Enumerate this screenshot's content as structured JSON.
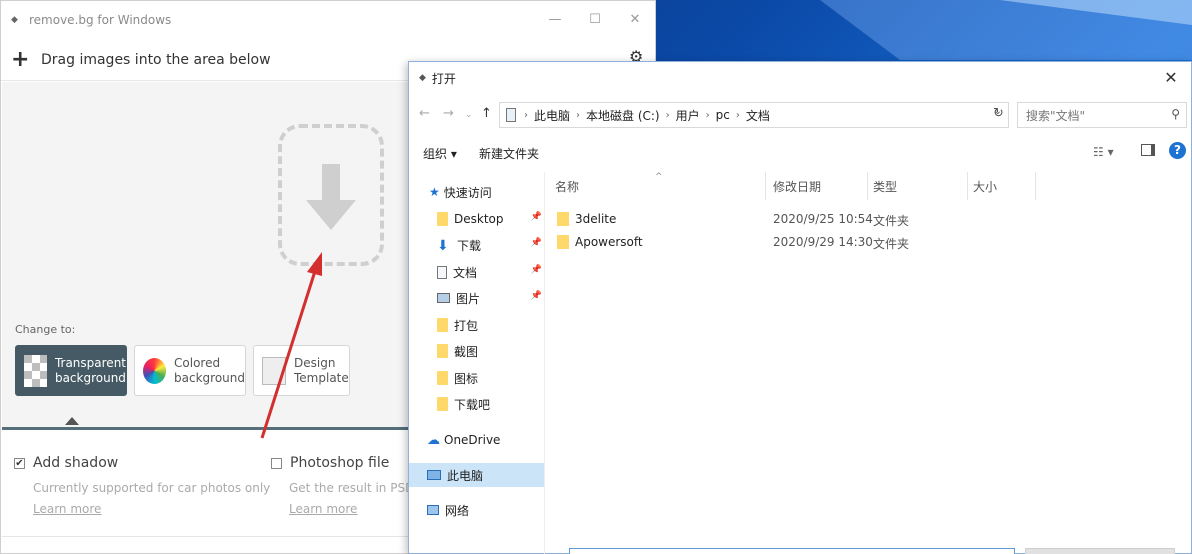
{
  "removebg": {
    "title": "remove.bg for Windows",
    "toolbar_label": "Drag images into the area below",
    "change_to_label": "Change to:",
    "options": [
      {
        "line1": "Transparent",
        "line2": "background"
      },
      {
        "line1": "Colored",
        "line2": "background"
      },
      {
        "line1": "Design",
        "line2": "Template"
      }
    ],
    "add_shadow": {
      "title": "Add shadow",
      "sub": "Currently supported for car photos only",
      "link": "Learn more"
    },
    "photoshop": {
      "title": "Photoshop file",
      "sub": "Get the result in PSD for",
      "link": "Learn more"
    },
    "colors": {
      "active_option": "#455a64",
      "divider": "#546e7a"
    }
  },
  "dialog": {
    "title": "打开",
    "breadcrumb": [
      "此电脑",
      "本地磁盘 (C:)",
      "用户",
      "pc",
      "文档"
    ],
    "search_placeholder": "搜索\"文档\"",
    "commands": {
      "organize": "组织 ▾",
      "new_folder": "新建文件夹"
    },
    "nav": {
      "quick_access": "快速访问",
      "items": [
        "Desktop",
        "下载",
        "文档",
        "图片",
        "打包",
        "截图",
        "图标",
        "下载吧"
      ],
      "onedrive": "OneDrive",
      "this_pc": "此电脑",
      "network": "网络"
    },
    "columns": {
      "name": "名称",
      "modified": "修改日期",
      "type": "类型",
      "size": "大小"
    },
    "files": [
      {
        "name": "3delite",
        "modified": "2020/9/25 10:54",
        "type": "文件夹"
      },
      {
        "name": "Apowersoft",
        "modified": "2020/9/29 14:30",
        "type": "文件夹"
      }
    ]
  }
}
